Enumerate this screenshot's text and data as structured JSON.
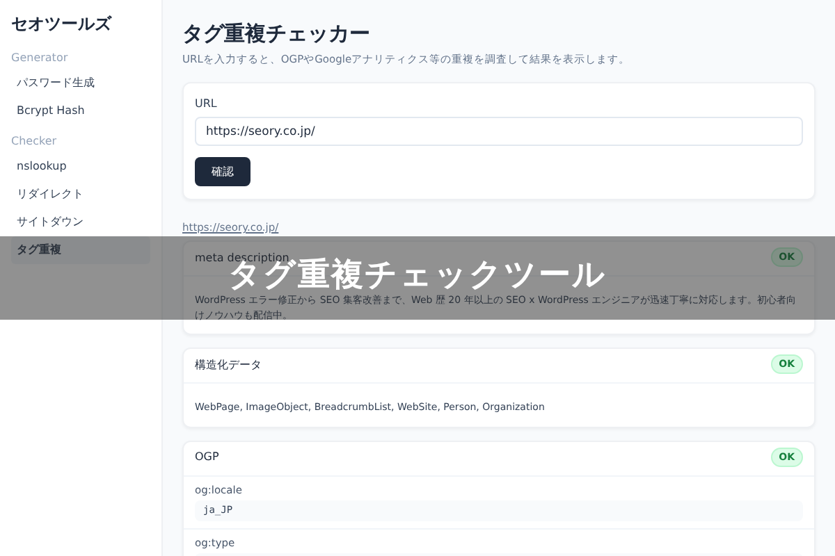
{
  "sidebar": {
    "title": "セオツールズ",
    "groups": [
      {
        "label": "Generator",
        "items": [
          {
            "label": "パスワード生成",
            "selected": false
          },
          {
            "label": "Bcrypt Hash",
            "selected": false
          }
        ]
      },
      {
        "label": "Checker",
        "items": [
          {
            "label": "nslookup",
            "selected": false
          },
          {
            "label": "リダイレクト",
            "selected": false
          },
          {
            "label": "サイトダウン",
            "selected": false
          },
          {
            "label": "タグ重複",
            "selected": true
          }
        ]
      }
    ]
  },
  "main": {
    "title": "タグ重複チェッカー",
    "subtitle": "URLを入力すると、OGPやGoogleアナリティクス等の重複を調査して結果を表示します。",
    "form": {
      "label": "URL",
      "value": "https://seory.co.jp/",
      "button": "確認"
    },
    "result_url": "https://seory.co.jp/",
    "sections": [
      {
        "kind": "text",
        "title": "meta description",
        "status": "OK",
        "body": "WordPress エラー修正から SEO 集客改善まで、Web 歴 20 年以上の SEO x WordPress エンジニアが迅速丁寧に対応します。初心者向けノウハウも配信中。"
      },
      {
        "kind": "text",
        "title": "構造化データ",
        "status": "OK",
        "body": "WebPage, ImageObject, BreadcrumbList, WebSite, Person, Organization"
      },
      {
        "kind": "fields",
        "title": "OGP",
        "status": "OK",
        "fields": [
          {
            "name": "og:locale",
            "value": "ja_JP"
          },
          {
            "name": "og:type"
          }
        ]
      }
    ]
  },
  "banner": {
    "text": "タグ重複チェックツール"
  }
}
